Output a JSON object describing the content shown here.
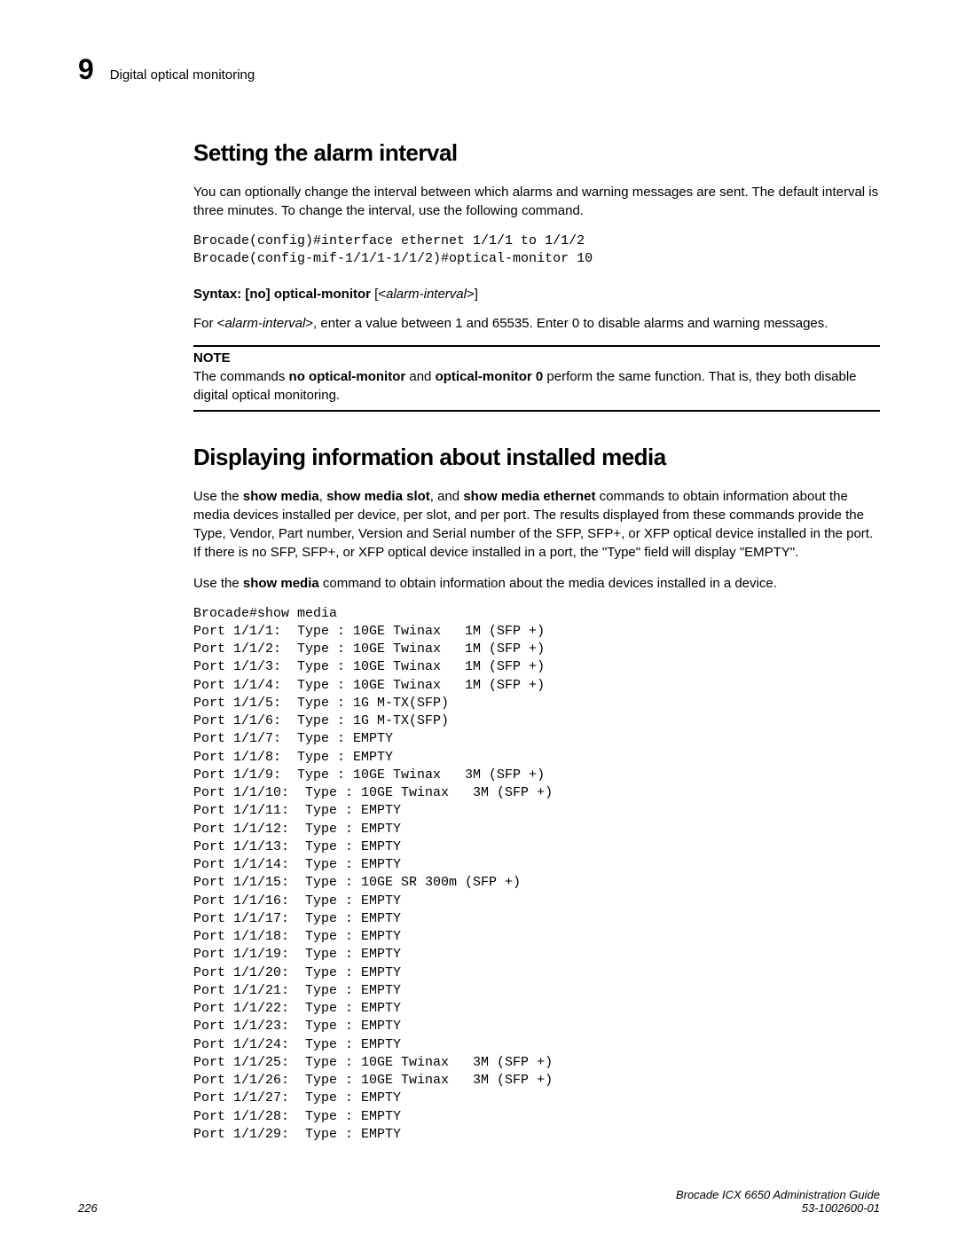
{
  "header": {
    "chapter_num": "9",
    "title": "Digital optical monitoring"
  },
  "section1": {
    "heading": "Setting the alarm interval",
    "para1": "You can optionally change the interval between which alarms and warning messages are sent. The default interval is three minutes. To change the interval, use the following command.",
    "code1": "Brocade(config)#interface ethernet 1/1/1 to 1/1/2\nBrocade(config-mif-1/1/1-1/1/2)#optical-monitor 10",
    "syntax_prefix": "Syntax:",
    "syntax_no": " [no] ",
    "syntax_cmd": "optical-monitor",
    "syntax_arg_open": " [<",
    "syntax_arg": "alarm-interval",
    "syntax_arg_close": ">]",
    "para2_pre": "For <",
    "para2_arg": "alarm-interval",
    "para2_post": ">, enter a value between 1 and 65535. Enter 0 to disable alarms and warning messages.",
    "note_label": "NOTE",
    "note_pre": "The commands ",
    "note_b1": "no optical-monitor",
    "note_mid": " and ",
    "note_b2": "optical-monitor 0",
    "note_post": " perform the same function. That is, they both disable digital optical monitoring."
  },
  "section2": {
    "heading": "Displaying information about installed media",
    "para1_pre": "Use the ",
    "para1_b1": "show media",
    "para1_c1": ", ",
    "para1_b2": "show media slot",
    "para1_c2": ", and ",
    "para1_b3": "show media ethernet",
    "para1_post": " commands to obtain information about the media devices installed per device, per slot, and per port. The results displayed from these commands provide the Type, Vendor, Part number, Version and Serial number of the SFP, SFP+, or XFP optical device installed in the port. If there is no SFP, SFP+, or XFP optical device installed in a port, the \"Type\" field will display \"EMPTY\".",
    "para2_pre": "Use the ",
    "para2_b1": "show media",
    "para2_post": " command to obtain information about the media devices installed in a device.",
    "code2": "Brocade#show media\nPort 1/1/1:  Type : 10GE Twinax   1M (SFP +)  \nPort 1/1/2:  Type : 10GE Twinax   1M (SFP +)  \nPort 1/1/3:  Type : 10GE Twinax   1M (SFP +)  \nPort 1/1/4:  Type : 10GE Twinax   1M (SFP +)  \nPort 1/1/5:  Type : 1G M-TX(SFP)\nPort 1/1/6:  Type : 1G M-TX(SFP)\nPort 1/1/7:  Type : EMPTY\nPort 1/1/8:  Type : EMPTY\nPort 1/1/9:  Type : 10GE Twinax   3M (SFP +)  \nPort 1/1/10:  Type : 10GE Twinax   3M (SFP +)  \nPort 1/1/11:  Type : EMPTY\nPort 1/1/12:  Type : EMPTY\nPort 1/1/13:  Type : EMPTY\nPort 1/1/14:  Type : EMPTY\nPort 1/1/15:  Type : 10GE SR 300m (SFP +)  \nPort 1/1/16:  Type : EMPTY\nPort 1/1/17:  Type : EMPTY\nPort 1/1/18:  Type : EMPTY\nPort 1/1/19:  Type : EMPTY\nPort 1/1/20:  Type : EMPTY\nPort 1/1/21:  Type : EMPTY\nPort 1/1/22:  Type : EMPTY\nPort 1/1/23:  Type : EMPTY\nPort 1/1/24:  Type : EMPTY\nPort 1/1/25:  Type : 10GE Twinax   3M (SFP +)  \nPort 1/1/26:  Type : 10GE Twinax   3M (SFP +)  \nPort 1/1/27:  Type : EMPTY\nPort 1/1/28:  Type : EMPTY\nPort 1/1/29:  Type : EMPTY"
  },
  "footer": {
    "page_num": "226",
    "guide": "Brocade ICX 6650 Administration Guide",
    "docnum": "53-1002600-01"
  }
}
